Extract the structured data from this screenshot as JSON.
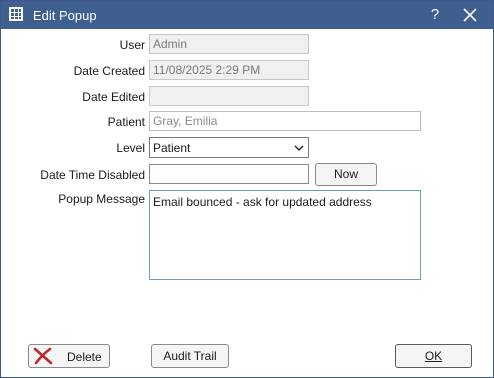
{
  "window": {
    "title": "Edit Popup",
    "help_glyph": "?"
  },
  "form": {
    "user_label": "User",
    "user_value": "Admin",
    "date_created_label": "Date Created",
    "date_created_value": "11/08/2025 2:29 PM",
    "date_edited_label": "Date Edited",
    "date_edited_value": "",
    "patient_label": "Patient",
    "patient_value": "Gray, Emilia",
    "level_label": "Level",
    "level_value": "Patient",
    "date_time_disabled_label": "Date Time Disabled",
    "date_time_disabled_value": "",
    "now_button": "Now",
    "popup_message_label": "Popup Message",
    "popup_message_value": "Email bounced - ask for updated address"
  },
  "footer": {
    "delete_button": "Delete",
    "audit_trail_button": "Audit Trail",
    "ok_button": "OK"
  },
  "colors": {
    "titlebar": "#3f5f91",
    "delete_icon": "#c0272d"
  },
  "icons": {
    "app": "grid-icon",
    "help": "help-icon",
    "close": "close-icon",
    "level_dropdown": "chevron-down-icon",
    "delete": "delete-x-icon"
  }
}
